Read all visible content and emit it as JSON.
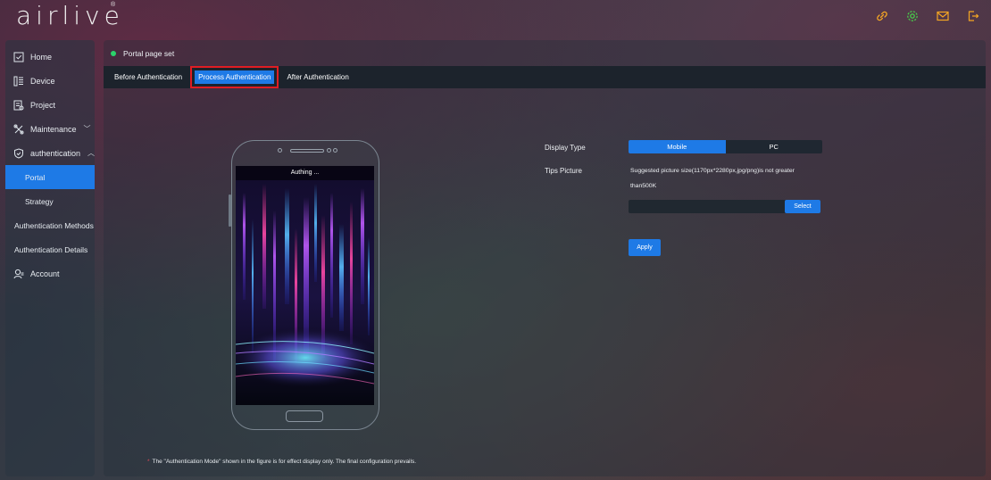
{
  "header": {
    "logo": "airlive",
    "icons": [
      "link-icon",
      "settings-icon",
      "mail-icon",
      "logout-icon"
    ],
    "icon_colors": {
      "link": "#f5a623",
      "settings": "#48c94a",
      "mail": "#f5a623",
      "logout": "#f5a623"
    }
  },
  "sidebar": {
    "items": [
      {
        "label": "Home",
        "icon": "home-icon"
      },
      {
        "label": "Device",
        "icon": "device-icon"
      },
      {
        "label": "Project",
        "icon": "project-icon"
      },
      {
        "label": "Maintenance",
        "icon": "maintenance-icon",
        "chevron": "﹀"
      },
      {
        "label": "authentication",
        "icon": "shield-icon",
        "chevron": "︿"
      }
    ],
    "sub_items": [
      {
        "label": "Portal",
        "active": true
      },
      {
        "label": "Strategy"
      },
      {
        "label": "Authentication Methods"
      },
      {
        "label": "Authentication Details"
      }
    ],
    "account": {
      "label": "Account",
      "icon": "account-icon"
    }
  },
  "main": {
    "title": "Portal page set",
    "tabs": [
      {
        "label": "Before Authentication"
      },
      {
        "label": "Process Authentication",
        "active": true
      },
      {
        "label": "After Authentication"
      }
    ],
    "preview": {
      "screen_title": "Authing ..."
    },
    "form": {
      "display_type_label": "Display Type",
      "display_options": [
        "Mobile",
        "PC"
      ],
      "display_selected": "Mobile",
      "tips_label": "Tips Picture",
      "tips_line1": "Suggested picture size(1170px*2280px,jpg/png)is not greater",
      "tips_line2": "than500K",
      "file_value": "",
      "select_label": "Select",
      "apply_label": "Apply"
    },
    "footnote_star": "*",
    "footnote": "The \"Authentication Mode\" shown in the figure is for effect display only. The final configuration prevails."
  },
  "colors": {
    "accent": "#1e7ae6",
    "highlight": "#e01d23",
    "status": "#2bd36b"
  }
}
